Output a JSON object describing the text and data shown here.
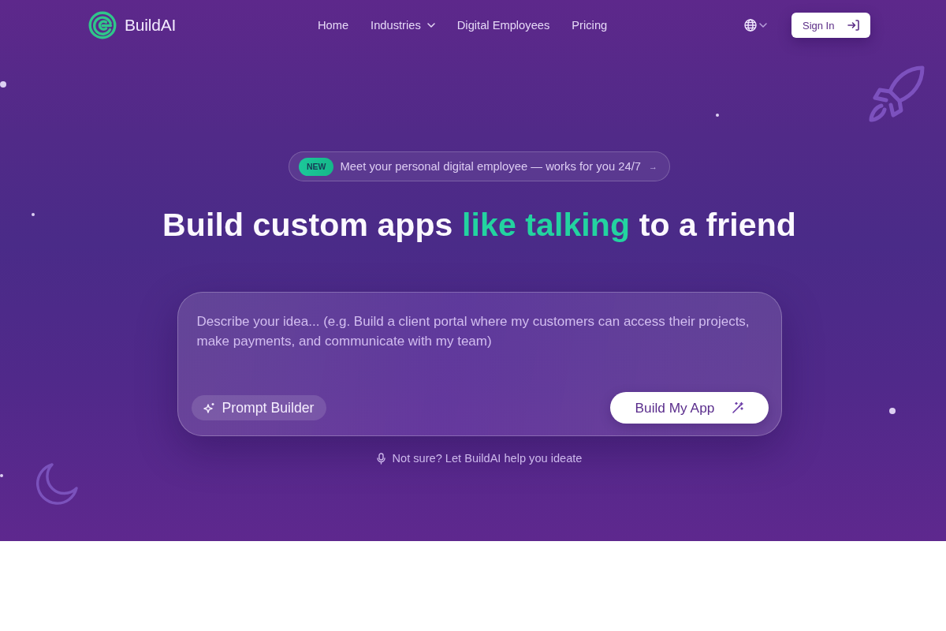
{
  "header": {
    "brand": "BuildAI",
    "nav": [
      {
        "label": "Home",
        "kind": "link"
      },
      {
        "label": "Industries",
        "kind": "dropdown"
      },
      {
        "label": "Digital Employees",
        "kind": "link"
      },
      {
        "label": "Pricing",
        "kind": "link"
      }
    ],
    "sign_in": "Sign In"
  },
  "announcement": {
    "badge": "NEW",
    "text": "Meet your personal digital employee — works for you 24/7",
    "arrow": "→"
  },
  "headline": [
    {
      "text": "Build custom apps",
      "kind": "plain"
    },
    {
      "text": "like talking",
      "kind": "accent"
    },
    {
      "text": "to a friend",
      "kind": "plain"
    }
  ],
  "prompt": {
    "placeholder": "Describe your idea... (e.g. Build a client portal where my customers can access their projects, make payments, and communicate with my team)",
    "prompt_builder": "Prompt Builder",
    "submit": "Build My App"
  },
  "ideate": "Not sure? Let BuildAI help you ideate"
}
